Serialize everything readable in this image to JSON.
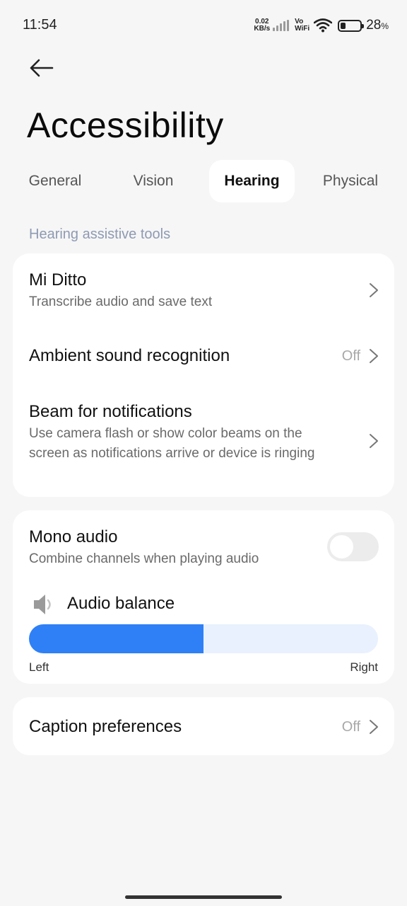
{
  "status_bar": {
    "time": "11:54",
    "net_speed_value": "0.02",
    "net_speed_unit": "KB/s",
    "vo_label": "Vo",
    "wifi_label": "WiFi",
    "battery_percent": "28",
    "battery_unit": "%",
    "battery_level": 0.28
  },
  "header": {
    "title": "Accessibility"
  },
  "tabs": [
    {
      "label": "General",
      "active": false
    },
    {
      "label": "Vision",
      "active": false
    },
    {
      "label": "Hearing",
      "active": true
    },
    {
      "label": "Physical",
      "active": false
    }
  ],
  "section": {
    "label": "Hearing assistive tools"
  },
  "hearing_tools": {
    "mi_ditto": {
      "title": "Mi Ditto",
      "subtitle": "Transcribe audio and save text"
    },
    "ambient": {
      "title": "Ambient sound recognition",
      "value": "Off"
    },
    "beam": {
      "title": "Beam for notifications",
      "subtitle": "Use camera flash or show color beams on the screen as notifications arrive or device is ringing"
    }
  },
  "audio": {
    "mono": {
      "title": "Mono audio",
      "subtitle": "Combine channels when playing audio",
      "enabled": false
    },
    "balance": {
      "label": "Audio balance",
      "left_label": "Left",
      "right_label": "Right",
      "value": 0.5
    }
  },
  "captions": {
    "title": "Caption preferences",
    "value": "Off"
  },
  "colors": {
    "accent": "#2f80f6",
    "track": "#e9f1fe",
    "background": "#f6f6f6",
    "section_label": "#8e9ab3"
  },
  "icons": {
    "back": "arrow-left-icon",
    "chevron": "chevron-right-icon",
    "speaker": "speaker-icon",
    "wifi": "wifi-icon",
    "signal": "signal-icon",
    "battery": "battery-icon"
  }
}
